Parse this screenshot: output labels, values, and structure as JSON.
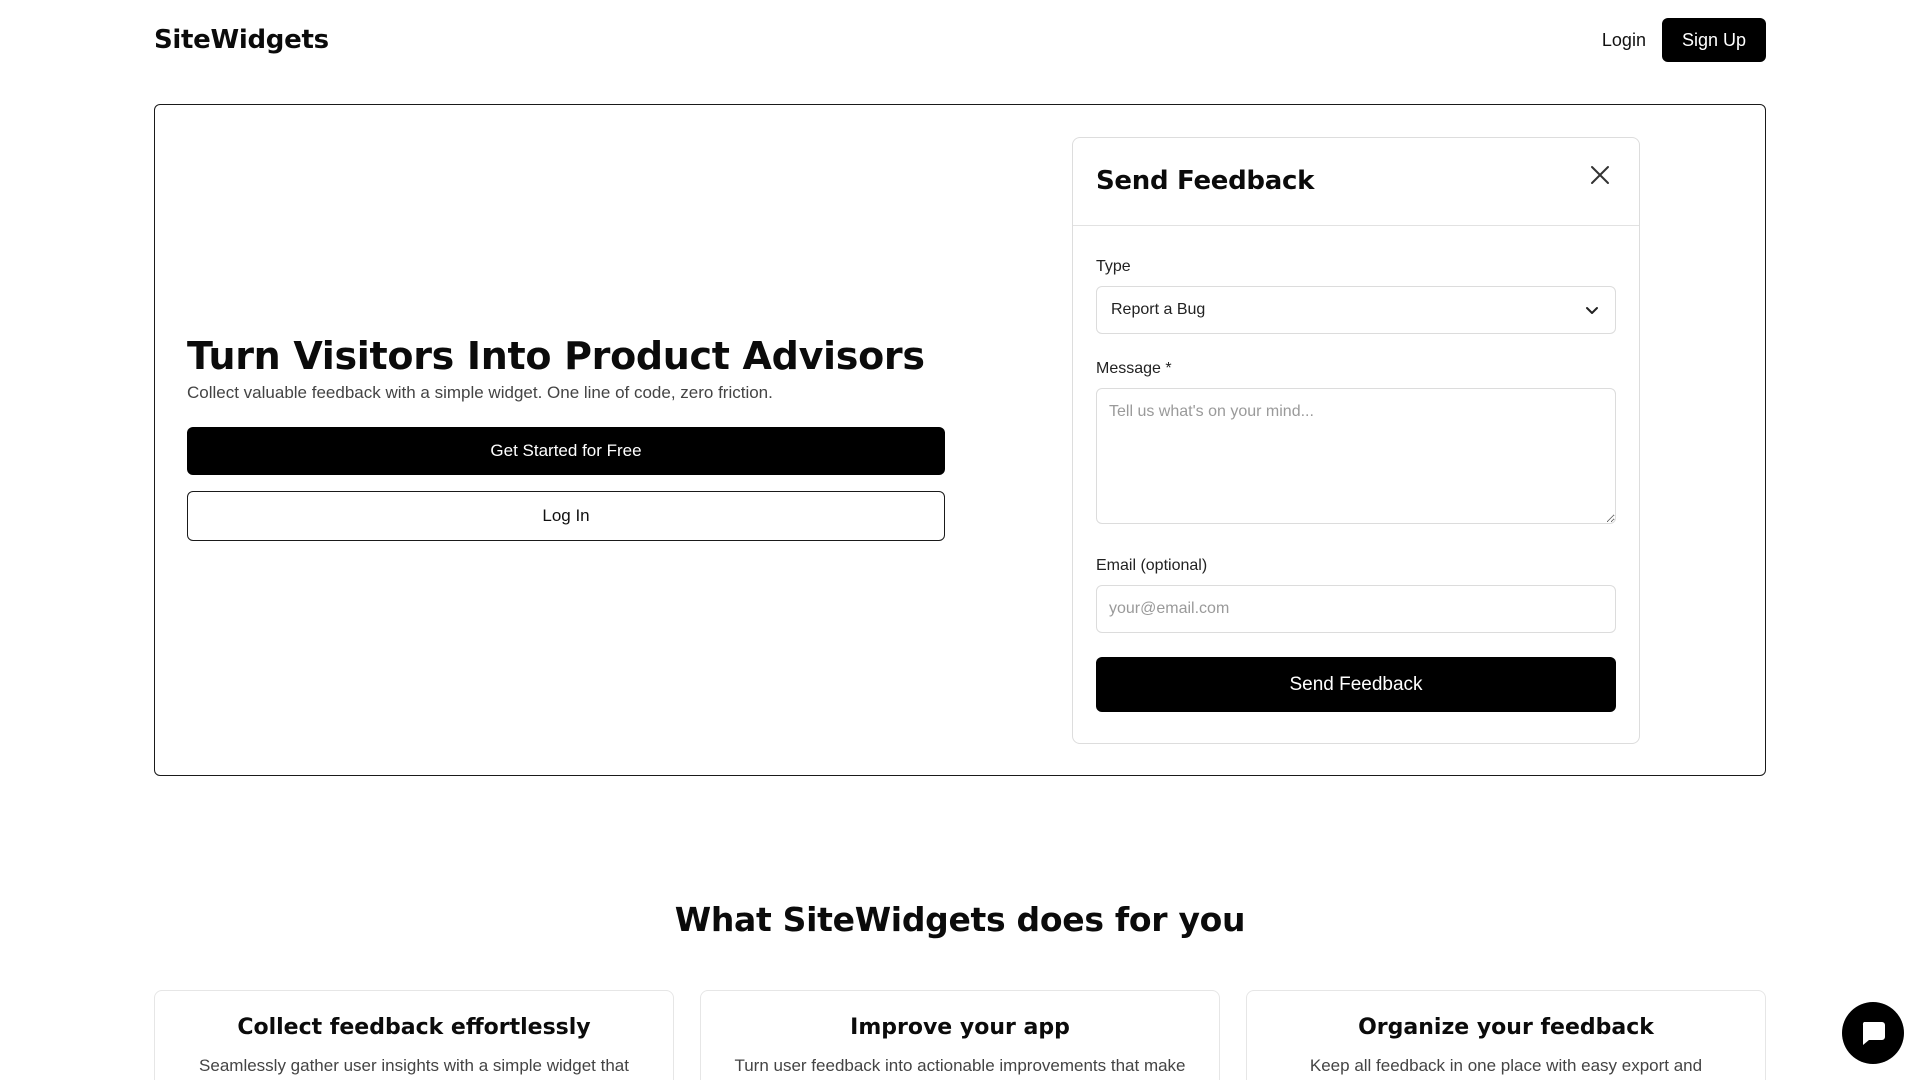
{
  "header": {
    "brand": "SiteWidgets",
    "login_label": "Login",
    "signup_label": "Sign Up"
  },
  "hero": {
    "title": "Turn Visitors Into Product Advisors",
    "subtitle": "Collect valuable feedback with a simple widget. One line of code, zero friction.",
    "primary_label": "Get Started for Free",
    "secondary_label": "Log In"
  },
  "widget": {
    "title": "Send Feedback",
    "type_label": "Type",
    "type_value": "Report a Bug",
    "message_label": "Message *",
    "message_placeholder": "Tell us what's on your mind...",
    "email_label": "Email (optional)",
    "email_placeholder": "your@email.com",
    "submit_label": "Send Feedback"
  },
  "features": {
    "title": "What SiteWidgets does for you",
    "cards": [
      {
        "title": "Collect feedback effortlessly",
        "desc": "Seamlessly gather user insights with a simple widget that"
      },
      {
        "title": "Improve your app",
        "desc": "Turn user feedback into actionable improvements that make"
      },
      {
        "title": "Organize your feedback",
        "desc": "Keep all feedback in one place with easy export and"
      }
    ]
  },
  "icons": {
    "close": "close-icon",
    "select_arrow": "chevron-down-icon",
    "chat": "chat-bubble-icon"
  },
  "colors": {
    "primary": "#000000",
    "border": "#1a1a1a",
    "muted_text": "#444444"
  }
}
